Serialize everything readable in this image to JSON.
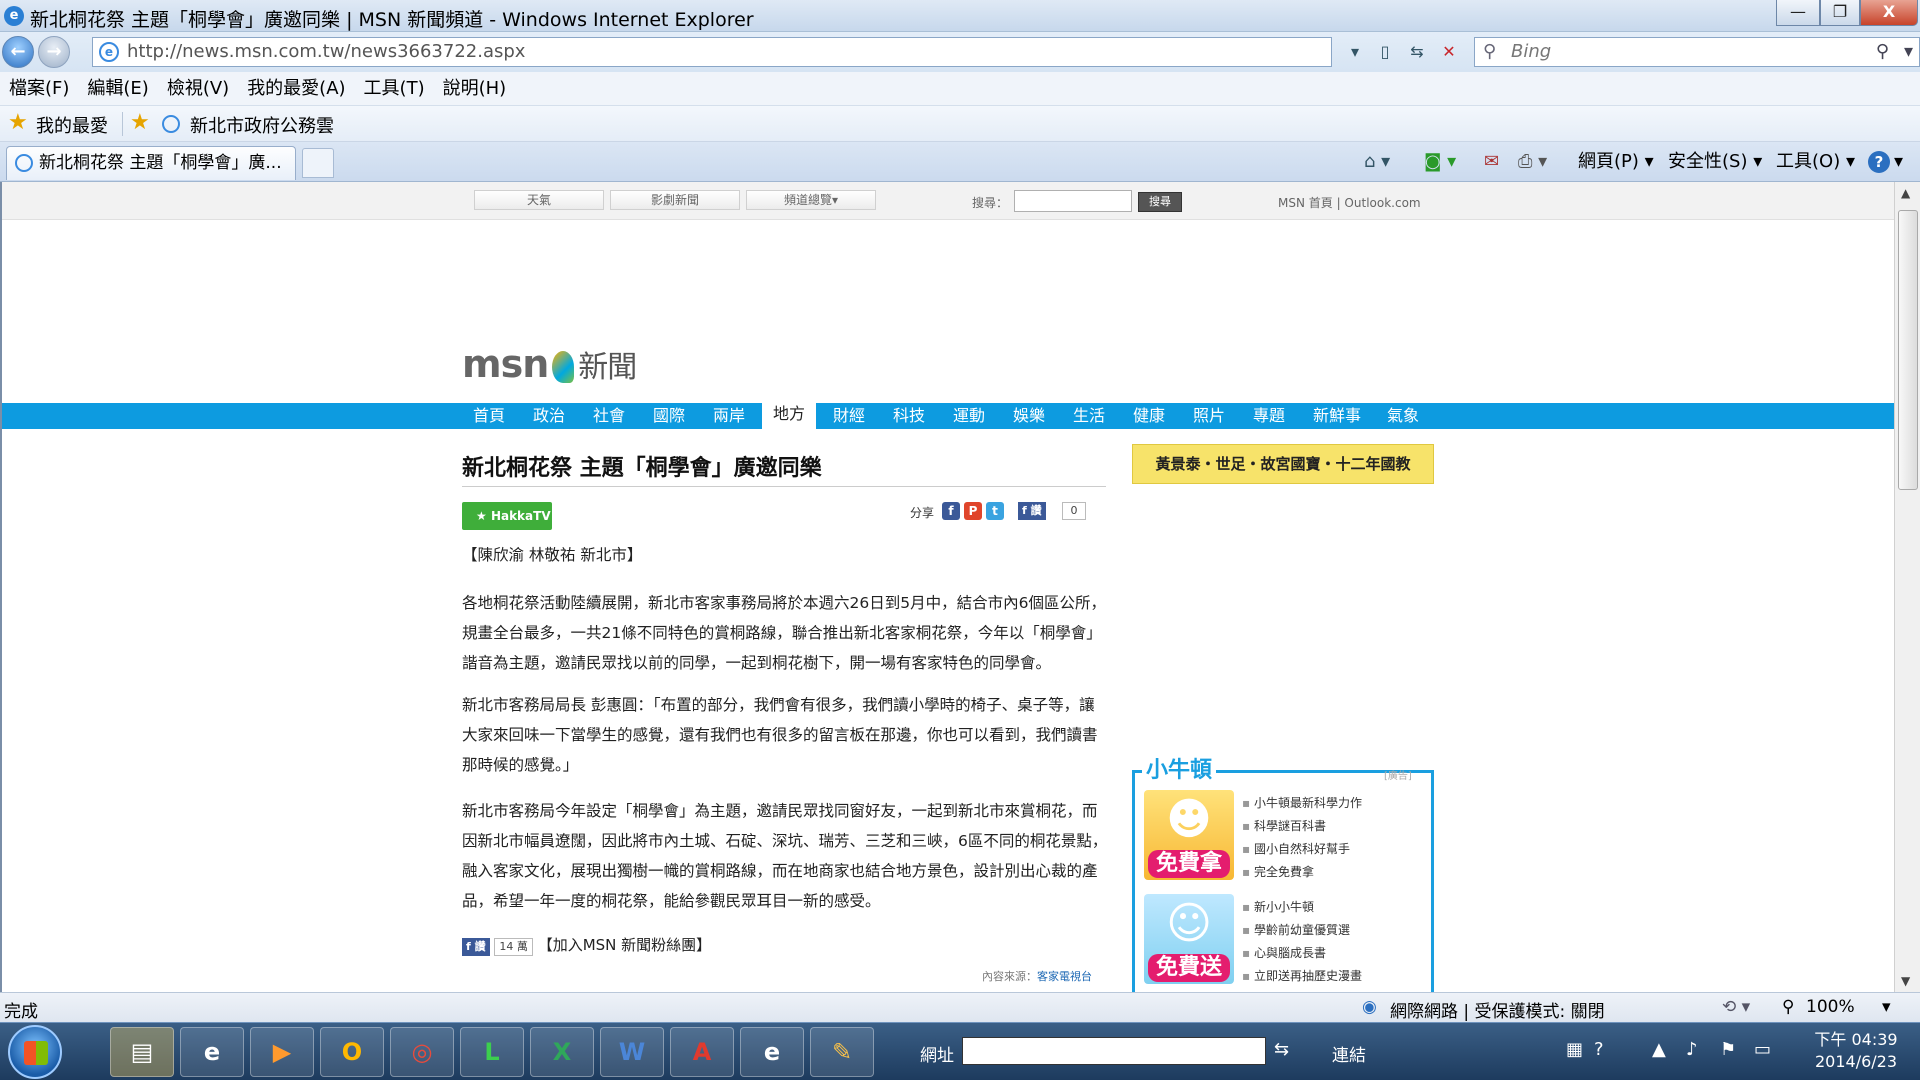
{
  "window": {
    "title": "新北桐花祭 主題「桐學會」廣邀同樂 | MSN 新聞頻道 - Windows Internet Explorer",
    "btn_min": "—",
    "btn_max": "❐",
    "btn_close": "X"
  },
  "address": {
    "url": "http://news.msn.com.tw/news3663722.aspx",
    "search_placeholder": "Bing"
  },
  "menu": [
    "檔案(F)",
    "編輯(E)",
    "檢視(V)",
    "我的最愛(A)",
    "工具(T)",
    "說明(H)"
  ],
  "favorites": {
    "label": "我的最愛",
    "item": "新北市政府公務雲"
  },
  "tab": {
    "title": "新北桐花祭 主題「桐學會」廣..."
  },
  "commands": {
    "page": "網頁(P)",
    "safety": "安全性(S)",
    "tools": "工具(O)"
  },
  "msn_strip": {
    "weather": "天氣",
    "video": "影劇新聞",
    "channels": "頻道總覽",
    "search_label": "搜尋：",
    "search_btn": "搜尋",
    "links": "MSN 首頁 | Outlook.com"
  },
  "logo": {
    "msn": "msn",
    "news": "新聞"
  },
  "nav": [
    "首頁",
    "政治",
    "社會",
    "國際",
    "兩岸",
    "地方",
    "財經",
    "科技",
    "運動",
    "娛樂",
    "生活",
    "健康",
    "照片",
    "專題",
    "新鮮事",
    "氣象"
  ],
  "nav_active": "地方",
  "article": {
    "headline": "新北桐花祭 主題「桐學會」廣邀同樂",
    "badge": "HakkaTV",
    "share_label": "分享",
    "fb_like": "讚",
    "fb_count": "0",
    "byline": "【陳欣渝 林敬祐 新北市】",
    "p1": "各地桐花祭活動陸續展開，新北市客家事務局將於本週六26日到5月中，結合市內6個區公所，規畫全台最多，一共21條不同特色的賞桐路線，聯合推出新北客家桐花祭，今年以「桐學會」諧音為主題，邀請民眾找以前的同學，一起到桐花樹下，開一場有客家特色的同學會。",
    "p2": "新北市客務局局長 彭惠圓：「布置的部分，我們會有很多，我們讀小學時的椅子、桌子等，讓大家來回味一下當學生的感覺，還有我們也有很多的留言板在那邊，你也可以看到，我們讀書那時候的感覺。」",
    "p3": "新北市客務局今年設定「桐學會」為主題，邀請民眾找同窗好友，一起到新北市來賞桐花，而因新北市幅員遼闊，因此將市內土城、石碇、深坑、瑞芳、三芝和三峽，6區不同的桐花景點，融入客家文化，展現出獨樹一幟的賞桐路線，而在地商家也結合地方景色，設計別出心裁的產品，希望一年一度的桐花祭，能給參觀民眾耳目一新的感受。",
    "fans_like": "讚",
    "fans_count": "14 萬",
    "fans_text": "【加入MSN 新聞粉絲團】",
    "source_label": "內容來源：",
    "source_value": "客家電視台"
  },
  "sidebar": {
    "banner": "黃景泰・世足・故宮國寶・十二年國教",
    "box_title": "小牛頓",
    "ad_label": "[廣告]",
    "img1_label": "免費拿",
    "img2_label": "免費送",
    "list1": [
      "小牛頓最新科學力作",
      "科學謎百科書",
      "國小自然科好幫手",
      "完全免費拿"
    ],
    "list2": [
      "新小小牛頓",
      "學齡前幼童優質選",
      "心與腦成長書",
      "立即送再抽歷史漫畫"
    ]
  },
  "status": {
    "text": "完成",
    "zone": "網際網路 | 受保護模式: 關閉",
    "zoom": "100%"
  },
  "taskbar": {
    "address_label": "網址",
    "links_label": "連結",
    "time": "下午 04:39",
    "date": "2014/6/23"
  },
  "colors": {
    "nav_blue": "#0d9be0",
    "banner_yellow": "#f7e36a",
    "kid_blue": "#1a9fe0"
  }
}
